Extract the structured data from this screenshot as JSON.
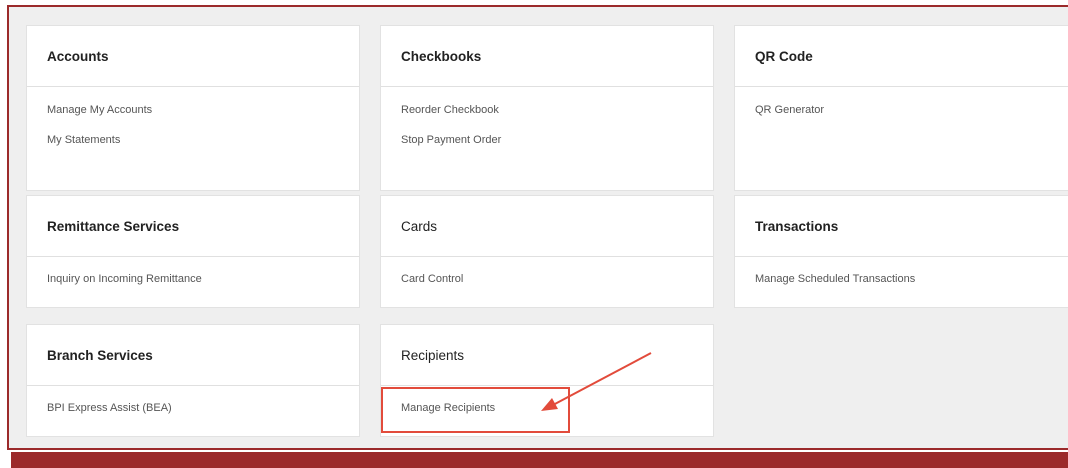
{
  "cards": [
    {
      "id": "accounts",
      "title": "Accounts",
      "links": [
        "Manage My Accounts",
        "My Statements"
      ]
    },
    {
      "id": "checkbooks",
      "title": "Checkbooks",
      "links": [
        "Reorder Checkbook",
        "Stop Payment Order"
      ]
    },
    {
      "id": "qr-code",
      "title": "QR Code",
      "links": [
        "QR Generator"
      ]
    },
    {
      "id": "remittance-services",
      "title": "Remittance Services",
      "links": [
        "Inquiry on Incoming Remittance"
      ]
    },
    {
      "id": "cards",
      "title": "Cards",
      "links": [
        "Card Control"
      ]
    },
    {
      "id": "transactions",
      "title": "Transactions",
      "links": [
        "Manage Scheduled Transactions"
      ]
    },
    {
      "id": "branch-services",
      "title": "Branch Services",
      "links": [
        "BPI Express Assist (BEA)"
      ]
    },
    {
      "id": "recipients",
      "title": "Recipients",
      "links": [
        "Manage Recipients"
      ]
    }
  ],
  "colors": {
    "frame_border": "#9b2a2b",
    "panel_bg": "#efefef",
    "annotation": "#e24b3b"
  }
}
